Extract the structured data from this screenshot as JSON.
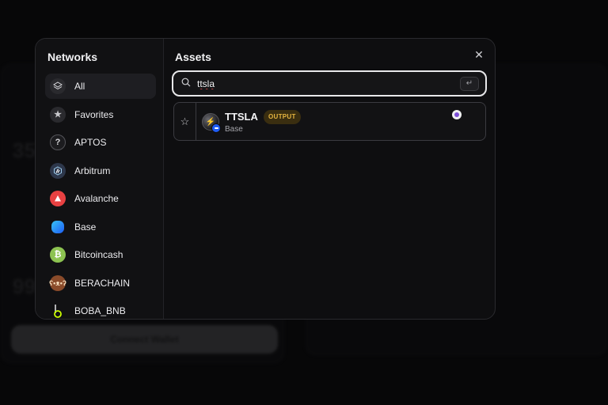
{
  "background": {
    "connect_wallet_label": "Connect Wallet"
  },
  "sidebar": {
    "title": "Networks",
    "items": [
      {
        "label": "All",
        "icon": "layers-icon",
        "active": true
      },
      {
        "label": "Favorites",
        "icon": "star-icon"
      },
      {
        "label": "APTOS",
        "icon": "aptos-icon"
      },
      {
        "label": "Arbitrum",
        "icon": "arbitrum-icon"
      },
      {
        "label": "Avalanche",
        "icon": "avalanche-icon"
      },
      {
        "label": "Base",
        "icon": "base-icon"
      },
      {
        "label": "Bitcoincash",
        "icon": "bitcoincash-icon"
      },
      {
        "label": "BERACHAIN",
        "icon": "berachain-icon"
      },
      {
        "label": "BOBA_BNB",
        "icon": "boba-bnb-icon"
      }
    ]
  },
  "assets": {
    "title": "Assets",
    "search": {
      "value": "ttsla",
      "placeholder": ""
    },
    "results": [
      {
        "symbol": "TTSLA",
        "badge": "OUTPUT",
        "chain": "Base"
      }
    ]
  },
  "colors": {
    "accent_badge": "#e6b540",
    "base_blue": "#1e5cf5"
  }
}
